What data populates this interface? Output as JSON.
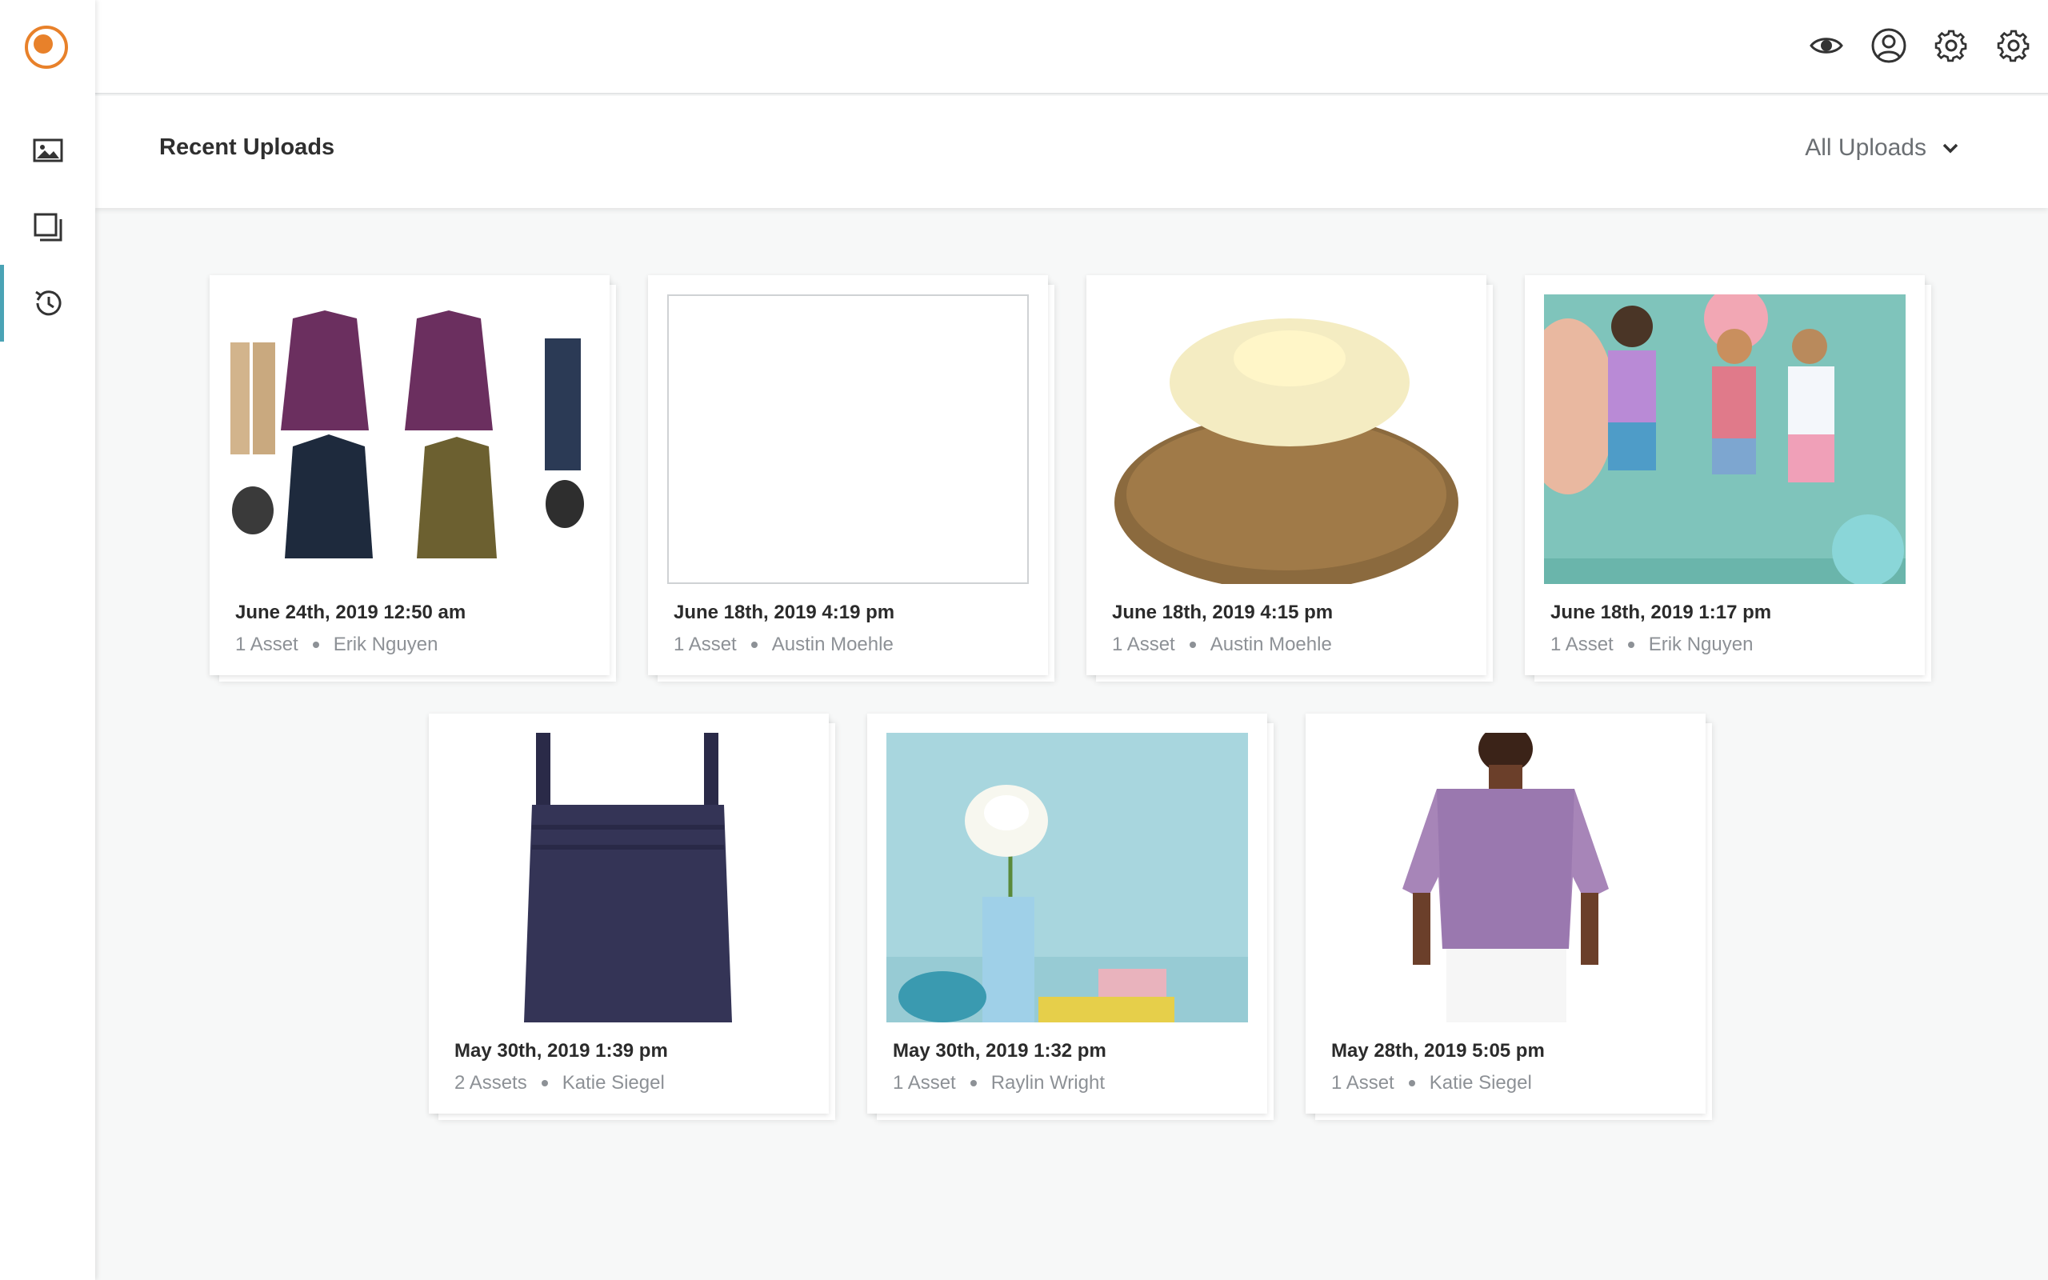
{
  "header": {
    "icons": [
      "eye-icon",
      "user-icon",
      "settings-icon",
      "settings-icon"
    ]
  },
  "sidebar": {
    "logo": "app-logo",
    "items": [
      {
        "icon": "image-icon",
        "active": false
      },
      {
        "icon": "collections-icon",
        "active": false
      },
      {
        "icon": "history-icon",
        "active": true
      }
    ]
  },
  "page": {
    "title": "Recent Uploads",
    "filter_label": "All Uploads"
  },
  "uploads": [
    {
      "date": "June 24th, 2019 12:50 am",
      "assets": "1 Asset",
      "user": "Erik Nguyen",
      "thumbnail": "clothing flat lay"
    },
    {
      "date": "June 18th, 2019 4:19 pm",
      "assets": "1 Asset",
      "user": "Austin Moehle",
      "thumbnail": "blank"
    },
    {
      "date": "June 18th, 2019 4:15 pm",
      "assets": "1 Asset",
      "user": "Austin Moehle",
      "thumbnail": "baked potato"
    },
    {
      "date": "June 18th, 2019 1:17 pm",
      "assets": "1 Asset",
      "user": "Erik Nguyen",
      "thumbnail": "kids on teal background"
    },
    {
      "date": "May 30th, 2019 1:39 pm",
      "assets": "2 Assets",
      "user": "Katie Siegel",
      "thumbnail": "navy top"
    },
    {
      "date": "May 30th, 2019 1:32 pm",
      "assets": "1 Asset",
      "user": "Raylin Wright",
      "thumbnail": "flower in vase"
    },
    {
      "date": "May 28th, 2019 5:05 pm",
      "assets": "1 Asset",
      "user": "Katie Siegel",
      "thumbnail": "patterned blouse"
    }
  ],
  "colors": {
    "accent": "#e8812a",
    "active_indicator": "#4aa3b5",
    "background": "#f7f8f8"
  }
}
